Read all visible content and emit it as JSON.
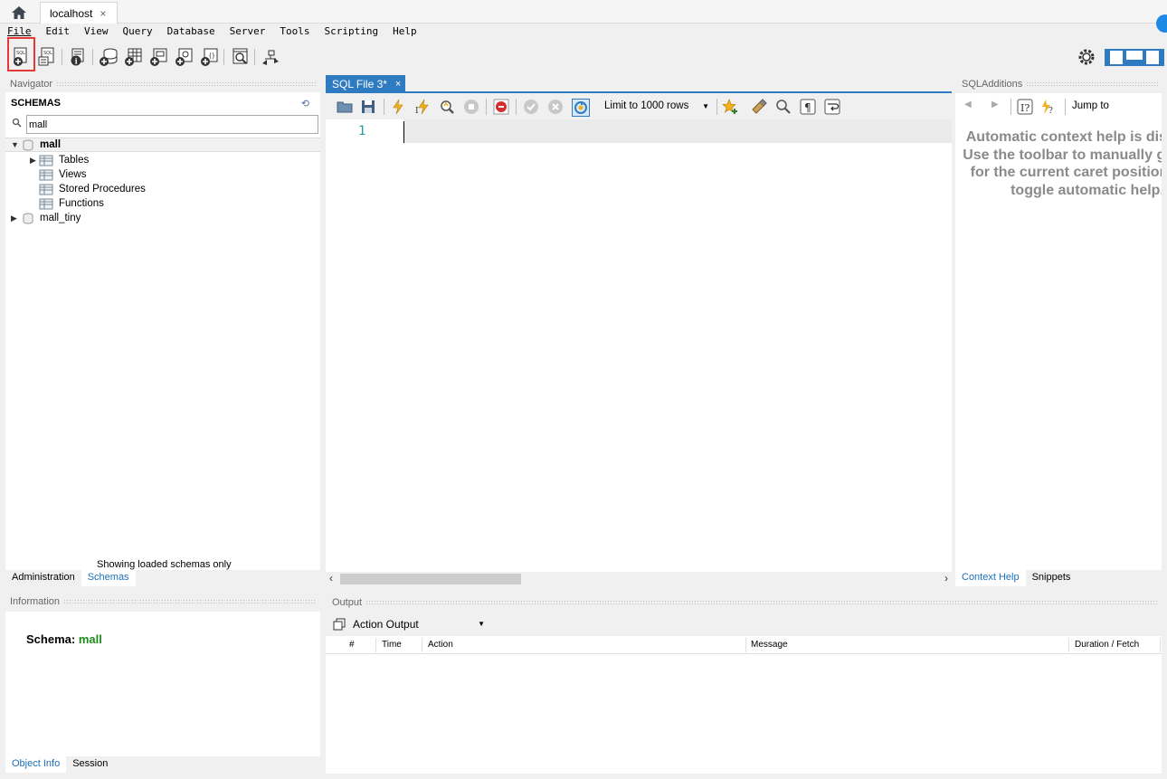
{
  "tabs": {
    "connection": "localhost",
    "close": "×"
  },
  "menu": [
    "File",
    "Edit",
    "View",
    "Query",
    "Database",
    "Server",
    "Tools",
    "Scripting",
    "Help"
  ],
  "navigator": {
    "title": "Navigator",
    "schemas_title": "SCHEMAS",
    "search_value": "mall",
    "tree": {
      "schema": "mall",
      "children": [
        "Tables",
        "Views",
        "Stored Procedures",
        "Functions"
      ],
      "other_schema": "mall_tiny"
    },
    "footer_note": "Showing loaded schemas only",
    "tabs": [
      "Administration",
      "Schemas"
    ]
  },
  "editor": {
    "tab_label": "SQL File 3*",
    "limit_label": "Limit to 1000 rows",
    "line_number": "1"
  },
  "sql_additions": {
    "title": "SQLAdditions",
    "jump_to": "Jump to",
    "context_help": "Automatic context help is disabled. Use the toolbar to manually get help for the current caret position or to toggle automatic help.",
    "tabs": [
      "Context Help",
      "Snippets"
    ]
  },
  "information": {
    "title": "Information",
    "schema_label": "Schema:",
    "schema_value": "mall",
    "tabs": [
      "Object Info",
      "Session"
    ]
  },
  "output": {
    "title": "Output",
    "selector": "Action Output",
    "columns": [
      "#",
      "Time",
      "Action",
      "Message",
      "Duration / Fetch"
    ]
  },
  "colors": {
    "accent": "#2f7bc1",
    "highlight": "#e53935",
    "schema_value": "#1a8a1a"
  }
}
